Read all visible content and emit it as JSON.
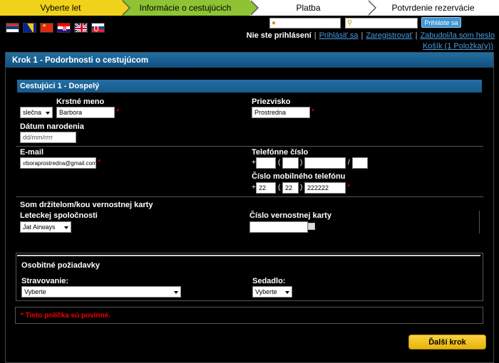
{
  "steps": [
    "Vyberte let",
    "Informácie o cestujúcich",
    "Platba",
    "Potvrdenie rezervácie"
  ],
  "header": {
    "login_button": "Prihláste sa",
    "not_logged": "Nie ste prihlásení",
    "login_link": "Prihlásiť sa",
    "register_link": "Zaregistrovať",
    "forgot_link": "Zabudol/la som heslo",
    "cart_link": "Košík (1 Položka(y))"
  },
  "panel_title": "Krok 1 - Podorbnosti o cestujúcom",
  "passenger": {
    "section_title": "Cestujúci 1 - Dospelý",
    "title_value": "slečna",
    "first_name_label": "Krstné meno",
    "first_name_value": "Barbora",
    "last_name_label": "Priezvisko",
    "last_name_value": "Prostredna",
    "dob_label": "Dátum narodenia",
    "dob_placeholder": "dd/mm/rrrr",
    "email_label": "E-mail",
    "email_value": "ırboraprostredna@gmail.com",
    "phone_label": "Telefónne číslo",
    "mobile_label": "Číslo mobilného telefónu",
    "mobile_country": "22",
    "mobile_area": "22",
    "mobile_number": "222222"
  },
  "loyalty": {
    "title": "Som držitelom/kou vernostnej karty",
    "airline_label": "Leteckej spoločnosti",
    "airline_value": "Jat Airways",
    "card_label": "Číslo vernostnej karty"
  },
  "special": {
    "title": "Osobitné požiadavky",
    "meal_label": "Stravovanie:",
    "meal_value": "Vyberte",
    "seat_label": "Sedadlo:",
    "seat_value": "Vyberte"
  },
  "required_note": "* Tieto políčka sú povinné.",
  "next_button": "Ďalší krok",
  "symbols": {
    "plus": "+",
    "open": "(",
    "close": ")",
    "slash": "/",
    "asterisk": "*"
  },
  "icons": {
    "flags": [
      "flag-serbia-icon",
      "flag-bosnia-icon",
      "flag-china-icon",
      "flag-croatia-icon",
      "flag-uk-icon",
      "flag-slovakia-icon"
    ]
  },
  "colors": {
    "step_done": "#f0d21a",
    "step_active": "#8ec334",
    "accent_blue": "#1f6ea4",
    "link": "#4a9be0",
    "required": "#e00000"
  }
}
